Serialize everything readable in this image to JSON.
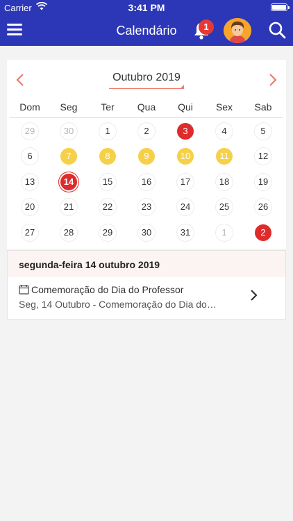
{
  "status_bar": {
    "carrier": "Carrier",
    "time": "3:41 PM"
  },
  "nav": {
    "title": "Calendário",
    "notification_count": "1",
    "menu_icon": "hamburger-menu-icon",
    "bell_icon": "bell-icon",
    "search_icon": "search-icon"
  },
  "calendar": {
    "month_label": "Outubro 2019",
    "weekdays": [
      "Dom",
      "Seg",
      "Ter",
      "Qua",
      "Qui",
      "Sex",
      "Sab"
    ],
    "days": [
      "29",
      "30",
      "1",
      "2",
      "3",
      "4",
      "5",
      "6",
      "7",
      "8",
      "9",
      "10",
      "11",
      "12",
      "13",
      "14",
      "15",
      "16",
      "17",
      "18",
      "19",
      "20",
      "21",
      "22",
      "23",
      "24",
      "25",
      "26",
      "27",
      "28",
      "29",
      "30",
      "31",
      "1",
      "2"
    ],
    "muted_days_index": [
      0,
      1,
      33
    ],
    "yellow_days_index": [
      8,
      9,
      10,
      11,
      12
    ],
    "red_days_index": [
      4,
      34
    ],
    "today_index": 15,
    "accent_color": "#ef7b6c",
    "event_yellow": "#f6d048",
    "event_red": "#de2b2b"
  },
  "selected_date": {
    "label": "segunda-feira 14 outubro 2019"
  },
  "event": {
    "title": "Comemoração do Dia do Professor",
    "subtitle": "Seg, 14 Outubro - Comemoração do Dia do…"
  },
  "colors": {
    "header_bg": "#2c37b8",
    "badge": "#e53935"
  }
}
